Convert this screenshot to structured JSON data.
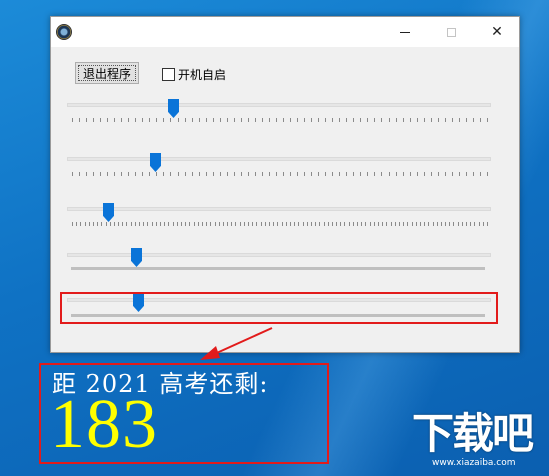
{
  "window": {
    "title": "",
    "app_icon": "app-gear-icon",
    "controls": {
      "minimize": "minimize-icon",
      "maximize": "maximize-icon",
      "close": "✕"
    }
  },
  "toolbar": {
    "exit_label": "退出程序",
    "autostart_label": "开机自启",
    "autostart_checked": false
  },
  "sliders": [
    {
      "name": "slider-1",
      "value_fraction": 0.25
    },
    {
      "name": "slider-2",
      "value_fraction": 0.205
    },
    {
      "name": "slider-3",
      "value_fraction": 0.09
    },
    {
      "name": "slider-4",
      "value_fraction": 0.16
    },
    {
      "name": "slider-5",
      "value_fraction": 0.165
    }
  ],
  "countdown": {
    "label": "距 2021 高考还剩:",
    "days": "183"
  },
  "watermark": {
    "logo_text": "下载吧",
    "url": "www.xiazaiba.com"
  },
  "colors": {
    "accent_thumb": "#0a74d8",
    "highlight_red": "#e21b1b",
    "days_yellow": "#ffff00",
    "desktop_blue": "#1279c8"
  }
}
